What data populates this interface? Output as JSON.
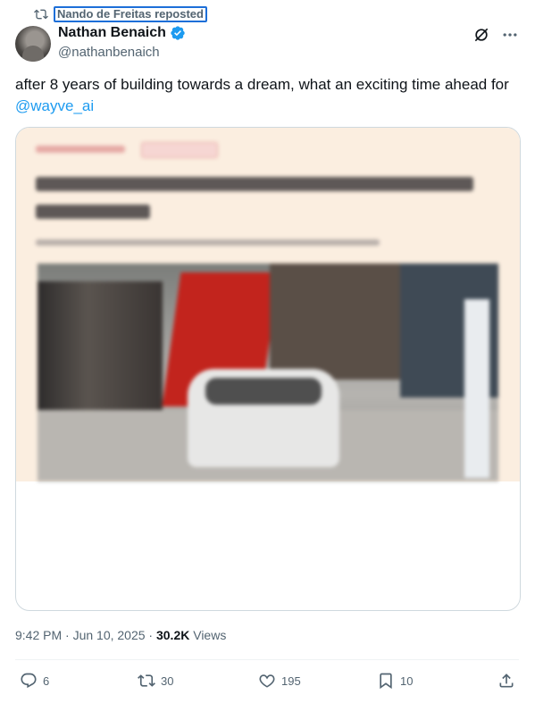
{
  "repost": {
    "text": "Nando de Freitas reposted"
  },
  "author": {
    "name": "Nathan Benaich",
    "handle": "@nathanbenaich"
  },
  "tweet": {
    "text": "after 8 years of building towards a dream, what an exciting time ahead for ",
    "mention": "@wayve_ai"
  },
  "meta": {
    "time": "9:42 PM · Jun 10, 2025 · ",
    "views": "30.2K",
    "views_label": " Views"
  },
  "actions": {
    "replies": "6",
    "reposts": "30",
    "likes": "195",
    "bookmarks": "10"
  },
  "icons": [
    "repost-icon",
    "verified-badge-icon",
    "grok-icon",
    "more-icon",
    "reply-icon",
    "like-icon",
    "bookmark-icon",
    "share-icon"
  ],
  "colors": {
    "accent": "#1d9bf0",
    "secondary_text": "#536471",
    "card_bg": "#fbeee0"
  }
}
